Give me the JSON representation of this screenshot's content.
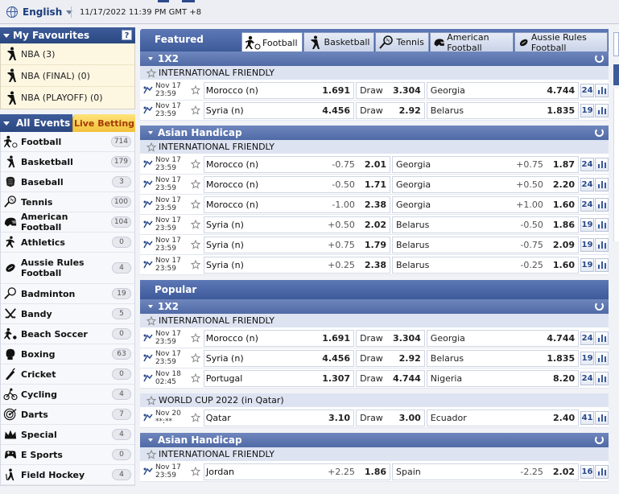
{
  "topbar": {
    "language": "English",
    "datetime": "11/17/2022 11:39 PM GMT +8"
  },
  "favourites": {
    "title": "My Favourites",
    "help": "?",
    "items": [
      {
        "label": "NBA (3)"
      },
      {
        "label": "NBA (FINAL) (0)"
      },
      {
        "label": "NBA (PLAYOFF) (0)"
      }
    ]
  },
  "events": {
    "all_label": "All Events",
    "live_label": "Live Betting",
    "sports": [
      {
        "label": "Football",
        "count": "714",
        "icon": "football-icon"
      },
      {
        "label": "Basketball",
        "count": "179",
        "icon": "basketball-icon"
      },
      {
        "label": "Baseball",
        "count": "3",
        "icon": "baseball-icon"
      },
      {
        "label": "Tennis",
        "count": "100",
        "icon": "tennis-icon"
      },
      {
        "label": "American Football",
        "count": "104",
        "icon": "american-football-icon"
      },
      {
        "label": "Athletics",
        "count": "0",
        "icon": "athletics-icon"
      },
      {
        "label": "Aussie Rules Football",
        "count": "4",
        "icon": "aussie-rules-icon"
      },
      {
        "label": "Badminton",
        "count": "19",
        "icon": "badminton-icon"
      },
      {
        "label": "Bandy",
        "count": "5",
        "icon": "bandy-icon"
      },
      {
        "label": "Beach Soccer",
        "count": "0",
        "icon": "beach-soccer-icon"
      },
      {
        "label": "Boxing",
        "count": "63",
        "icon": "boxing-icon"
      },
      {
        "label": "Cricket",
        "count": "0",
        "icon": "cricket-icon"
      },
      {
        "label": "Cycling",
        "count": "4",
        "icon": "cycling-icon"
      },
      {
        "label": "Darts",
        "count": "7",
        "icon": "darts-icon"
      },
      {
        "label": "Special",
        "count": "4",
        "icon": "special-icon"
      },
      {
        "label": "E Sports",
        "count": "0",
        "icon": "esports-icon"
      },
      {
        "label": "Field Hockey",
        "count": "4",
        "icon": "field-hockey-icon"
      }
    ]
  },
  "featured": {
    "title": "Featured",
    "tabs": [
      {
        "label": "Football",
        "icon": "football-icon"
      },
      {
        "label": "Basketball",
        "icon": "basketball-icon"
      },
      {
        "label": "Tennis",
        "icon": "tennis-icon"
      },
      {
        "label": "American Football",
        "icon": "american-football-icon"
      },
      {
        "label": "Aussie Rules Football",
        "icon": "aussie-rules-icon"
      }
    ],
    "x12": {
      "title": "1X2",
      "league": "INTERNATIONAL FRIENDLY",
      "rows": [
        {
          "date": "Nov 17",
          "time": "23:59",
          "home": "Morocco (n)",
          "home_odd": "1.691",
          "draw": "Draw",
          "draw_odd": "3.304",
          "away": "Georgia",
          "away_odd": "4.744",
          "markets": "24"
        },
        {
          "date": "Nov 17",
          "time": "23:59",
          "home": "Syria (n)",
          "home_odd": "4.456",
          "draw": "Draw",
          "draw_odd": "2.92",
          "away": "Belarus",
          "away_odd": "1.835",
          "markets": "19"
        }
      ]
    },
    "ah": {
      "title": "Asian Handicap",
      "league": "INTERNATIONAL FRIENDLY",
      "rows": [
        {
          "date": "Nov 17",
          "time": "23:59",
          "home": "Morocco (n)",
          "home_hcap": "-0.75",
          "home_odd": "2.01",
          "away": "Georgia",
          "away_hcap": "+0.75",
          "away_odd": "1.87",
          "markets": "24"
        },
        {
          "date": "Nov 17",
          "time": "23:59",
          "home": "Morocco (n)",
          "home_hcap": "-0.50",
          "home_odd": "1.71",
          "away": "Georgia",
          "away_hcap": "+0.50",
          "away_odd": "2.20",
          "markets": "24"
        },
        {
          "date": "Nov 17",
          "time": "23:59",
          "home": "Morocco (n)",
          "home_hcap": "-1.00",
          "home_odd": "2.38",
          "away": "Georgia",
          "away_hcap": "+1.00",
          "away_odd": "1.60",
          "markets": "24"
        },
        {
          "date": "Nov 17",
          "time": "23:59",
          "home": "Syria (n)",
          "home_hcap": "+0.50",
          "home_odd": "2.02",
          "away": "Belarus",
          "away_hcap": "-0.50",
          "away_odd": "1.86",
          "markets": "19"
        },
        {
          "date": "Nov 17",
          "time": "23:59",
          "home": "Syria (n)",
          "home_hcap": "+0.75",
          "home_odd": "1.79",
          "away": "Belarus",
          "away_hcap": "-0.75",
          "away_odd": "2.09",
          "markets": "19"
        },
        {
          "date": "Nov 17",
          "time": "23:59",
          "home": "Syria (n)",
          "home_hcap": "+0.25",
          "home_odd": "2.38",
          "away": "Belarus",
          "away_hcap": "-0.25",
          "away_odd": "1.60",
          "markets": "19"
        }
      ]
    }
  },
  "popular": {
    "title": "Popular",
    "x12": {
      "title": "1X2",
      "league": "INTERNATIONAL FRIENDLY",
      "rows": [
        {
          "date": "Nov 17",
          "time": "23:59",
          "home": "Morocco (n)",
          "home_odd": "1.691",
          "draw": "Draw",
          "draw_odd": "3.304",
          "away": "Georgia",
          "away_odd": "4.744",
          "markets": "24"
        },
        {
          "date": "Nov 17",
          "time": "23:59",
          "home": "Syria (n)",
          "home_odd": "4.456",
          "draw": "Draw",
          "draw_odd": "2.92",
          "away": "Belarus",
          "away_odd": "1.835",
          "markets": "19"
        },
        {
          "date": "Nov 18",
          "time": "02:45",
          "home": "Portugal",
          "home_odd": "1.307",
          "draw": "Draw",
          "draw_odd": "4.744",
          "away": "Nigeria",
          "away_odd": "8.20",
          "markets": "24"
        }
      ],
      "league2": "WORLD CUP 2022 (in Qatar)",
      "rows2": [
        {
          "date": "Nov 20",
          "time": "**:**",
          "home": "Qatar",
          "home_odd": "3.10",
          "draw": "Draw",
          "draw_odd": "3.00",
          "away": "Ecuador",
          "away_odd": "2.40",
          "markets": "41"
        }
      ]
    },
    "ah": {
      "title": "Asian Handicap",
      "league": "INTERNATIONAL FRIENDLY",
      "rows": [
        {
          "date": "Nov 17",
          "time": "23:59",
          "home": "Jordan",
          "home_hcap": "+2.25",
          "home_odd": "1.86",
          "away": "Spain",
          "away_hcap": "-2.25",
          "away_odd": "2.02",
          "markets": "16"
        }
      ]
    }
  },
  "colors": {
    "header_blue": "#3d5a9a",
    "section_blue": "#5f78b3",
    "league_bg": "#dde3f1",
    "live_yellow": "#f2c13a",
    "favourites_bg": "#fdf7e2"
  }
}
